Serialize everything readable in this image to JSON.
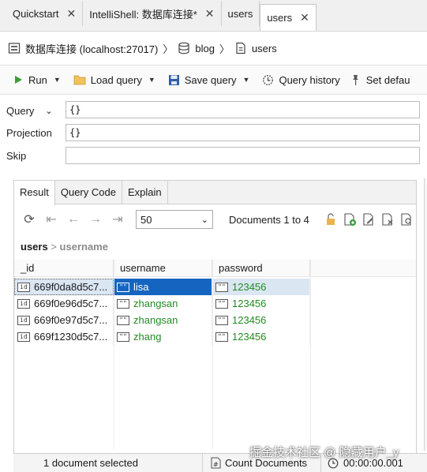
{
  "tabs": [
    {
      "label": "Quickstart",
      "closable": true,
      "active": false
    },
    {
      "label": "IntelliShell: 数据库连接*",
      "closable": true,
      "active": false
    },
    {
      "label": "users",
      "closable": false,
      "active": false
    },
    {
      "label": "users",
      "closable": true,
      "active": true
    }
  ],
  "breadcrumb": {
    "connection": "数据库连接 (localhost:27017)",
    "sep1": "〉",
    "database": "blog",
    "sep2": "〉",
    "collection": "users"
  },
  "toolbar": {
    "run": "Run",
    "load_query": "Load query",
    "save_query": "Save query",
    "query_history": "Query history",
    "set_default": "Set defau"
  },
  "query_form": {
    "query_label": "Query",
    "query_value": "{}",
    "projection_label": "Projection",
    "projection_value": "{}",
    "skip_label": "Skip",
    "skip_value": ""
  },
  "result_tabs": [
    "Result",
    "Query Code",
    "Explain"
  ],
  "pager": {
    "page_size": "50",
    "documents_text": "Documents 1 to 4"
  },
  "path": {
    "root": "users",
    "sep": ">",
    "field": "username"
  },
  "table": {
    "columns": [
      "_id",
      "username",
      "password"
    ],
    "rows": [
      {
        "id": "669f0da8d5c7...",
        "username": "lisa",
        "password": "123456"
      },
      {
        "id": "669f0e96d5c7...",
        "username": "zhangsan",
        "password": "123456"
      },
      {
        "id": "669f0e97d5c7...",
        "username": "zhangsan",
        "password": "123456"
      },
      {
        "id": "669f1230d5c7...",
        "username": "zhang",
        "password": "123456"
      }
    ],
    "selected_row": 0
  },
  "status": {
    "selection": "1 document selected",
    "count_documents": "Count Documents",
    "elapsed": "00:00:00.001"
  },
  "watermark": "掘金技术社区 @ 隐藏用户_y",
  "colors": {
    "selection_blue": "#1565c0",
    "value_green": "#228b22",
    "selection_light": "#dbe6f3"
  }
}
